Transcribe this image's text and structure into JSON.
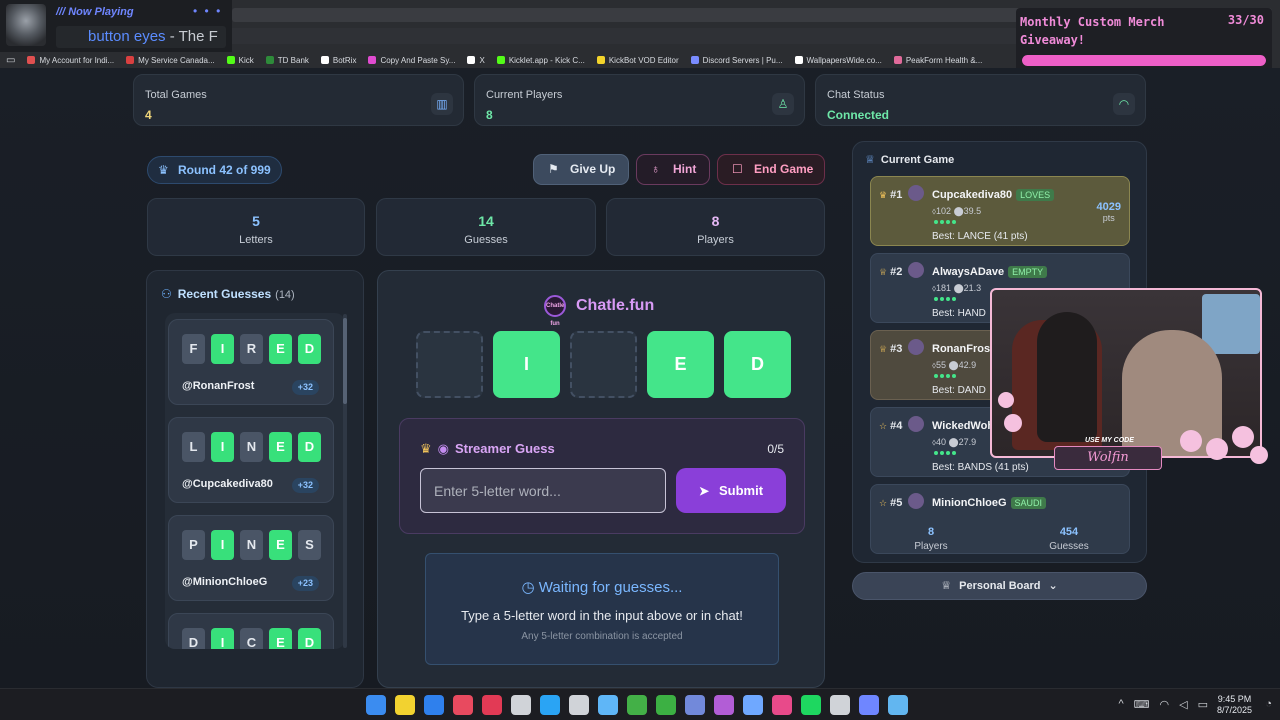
{
  "now_playing": {
    "label": "/// Now Playing",
    "dots": "• • •",
    "track_a": "button eyes",
    "track_b": " - The F"
  },
  "merch": {
    "title": "Monthly Custom Merch Giveaway!",
    "count": "33/30",
    "progress_fraction": 1.0
  },
  "bookmarks": [
    {
      "label": "My Account for Indi...",
      "color": "#e05050"
    },
    {
      "label": "My Service Canada...",
      "color": "#d94040"
    },
    {
      "label": "Kick",
      "color": "#53fc18"
    },
    {
      "label": "TD Bank",
      "color": "#2e8b3a"
    },
    {
      "label": "BotRix",
      "color": "#ffffff"
    },
    {
      "label": "Copy And Paste Sy...",
      "color": "#e04bd0"
    },
    {
      "label": "X",
      "color": "#ffffff"
    },
    {
      "label": "Kicklet.app - Kick C...",
      "color": "#53fc18"
    },
    {
      "label": "KickBot VOD Editor",
      "color": "#f3d42b"
    },
    {
      "label": "Discord Servers | Pu...",
      "color": "#7a8cff"
    },
    {
      "label": "WallpapersWide.co...",
      "color": "#ffffff"
    },
    {
      "label": "PeakForm Health &...",
      "color": "#e06a9a"
    }
  ],
  "stats": {
    "total_games": {
      "label": "Total Games",
      "value": "4"
    },
    "current_players": {
      "label": "Current Players",
      "value": "8"
    },
    "chat_status": {
      "label": "Chat Status",
      "value": "Connected"
    }
  },
  "round": {
    "label": "Round 42 of 999"
  },
  "controls": {
    "give_up": "Give Up",
    "hint": "Hint",
    "end_game": "End Game"
  },
  "summary": [
    {
      "value": "5",
      "label": "Letters",
      "color": "#8cc2ff"
    },
    {
      "value": "14",
      "label": "Guesses",
      "color": "#6ee7a8"
    },
    {
      "value": "8",
      "label": "Players",
      "color": "#e6b8f5"
    }
  ],
  "recent": {
    "title": "Recent Guesses",
    "count": "(14)",
    "items": [
      {
        "letters": [
          "F",
          "I",
          "R",
          "E",
          "D"
        ],
        "hits": [
          false,
          true,
          false,
          true,
          true
        ],
        "user": "@RonanFrost",
        "points": "+32"
      },
      {
        "letters": [
          "L",
          "I",
          "N",
          "E",
          "D"
        ],
        "hits": [
          false,
          true,
          false,
          true,
          true
        ],
        "user": "@Cupcakediva80",
        "points": "+32"
      },
      {
        "letters": [
          "P",
          "I",
          "N",
          "E",
          "S"
        ],
        "hits": [
          false,
          true,
          false,
          true,
          false
        ],
        "user": "@MinionChloeG",
        "points": "+23"
      },
      {
        "letters": [
          "D",
          "I",
          "C",
          "E",
          "D"
        ],
        "hits": [
          false,
          true,
          false,
          true,
          true
        ],
        "user": "",
        "points": ""
      }
    ]
  },
  "game": {
    "brand": "Chatle.fun",
    "brand_logo_text": "Chatle fun",
    "board": [
      "",
      "I",
      "",
      "E",
      "D"
    ],
    "streamer_guess": {
      "title": "Streamer Guess",
      "count": "0/5",
      "placeholder": "Enter 5-letter word...",
      "submit": "Submit"
    },
    "waiting": {
      "title": "Waiting for guesses...",
      "subtitle": "Type a 5-letter word in the input above or in chat!",
      "note": "Any 5-letter combination is accepted"
    }
  },
  "leaderboard": {
    "title": "Current Game",
    "entries": [
      {
        "rank": "#1",
        "name": "Cupcakediva80",
        "badge": "LOVES",
        "stats": "⬨102 ⬤39.5",
        "best": "Best: LANCE (41 pts)",
        "score": "4029",
        "score_unit": "pts"
      },
      {
        "rank": "#2",
        "name": "AlwaysADave",
        "badge": "EMPTY",
        "stats": "⬨181 ⬤21.3",
        "best": "Best: HAND",
        "score": "",
        "score_unit": ""
      },
      {
        "rank": "#3",
        "name": "RonanFrost",
        "badge": "",
        "stats": "⬨55 ⬤42.9",
        "best": "Best: DAND",
        "score": "",
        "score_unit": ""
      },
      {
        "rank": "#4",
        "name": "WickedWoh",
        "badge": "",
        "stats": "⬨40 ⬤27.9",
        "best": "Best: BANDS (41 pts)",
        "score": "",
        "score_unit": ""
      },
      {
        "rank": "#5",
        "name": "MinionChloeG",
        "badge": "SAUDI",
        "stats": "",
        "best": "",
        "score": "",
        "score_unit": ""
      }
    ],
    "footer": {
      "players": "8",
      "players_label": "Players",
      "guesses": "454",
      "guesses_label": "Guesses"
    }
  },
  "personal_board": {
    "label": "Personal Board"
  },
  "webcam": {
    "code_label": "USE MY CODE",
    "code": "Wolfin"
  },
  "clock": {
    "time": "9:45 PM",
    "date": "8/7/2025"
  }
}
